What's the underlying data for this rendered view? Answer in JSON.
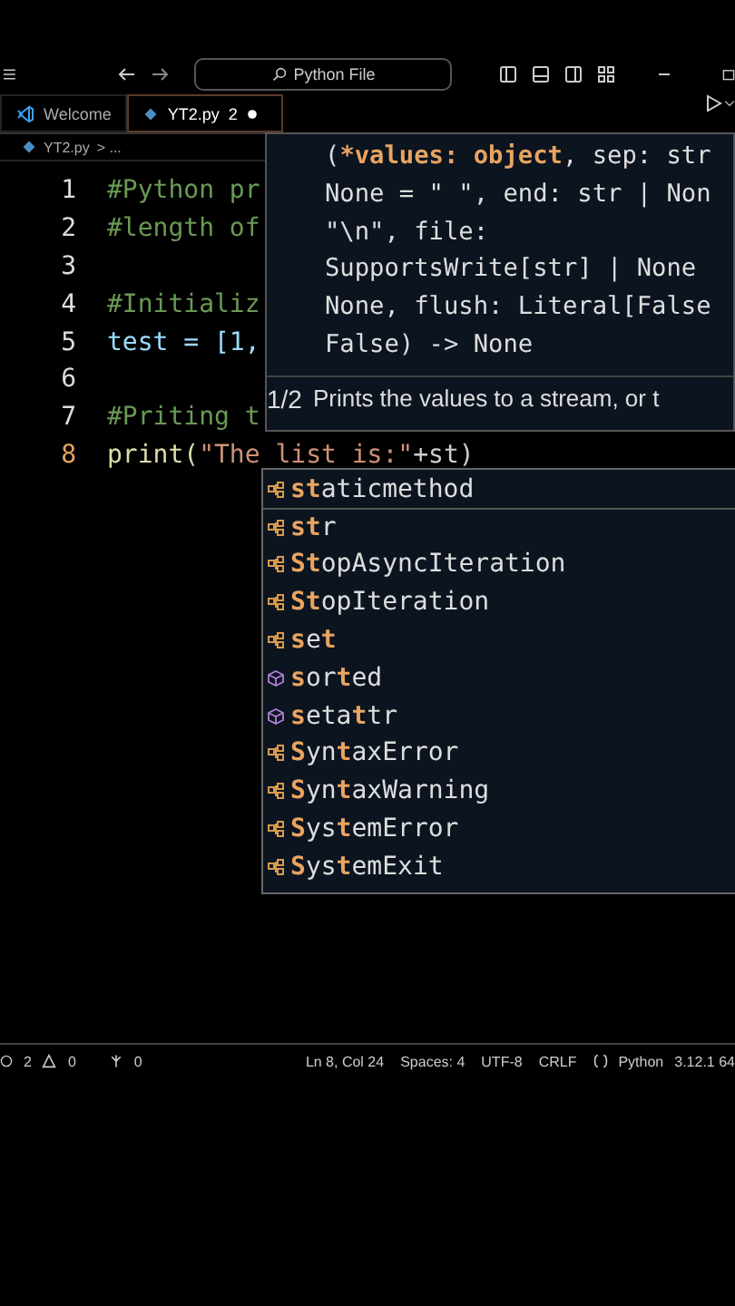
{
  "title_bar": {
    "search": "Python File"
  },
  "tabs": [
    {
      "label": "Welcome",
      "kind": "welcome",
      "selected": false,
      "modified": false
    },
    {
      "label": "YT2.py",
      "kind": "python",
      "selected": true,
      "problems": "2",
      "modified": true
    }
  ],
  "breadcrumb": {
    "file": "YT2.py",
    "rest": "> ..."
  },
  "code_lines": [
    {
      "number": "1",
      "text": "#Python pr",
      "kind": "comment",
      "current": false
    },
    {
      "number": "2",
      "text": "#length of",
      "kind": "comment",
      "current": false
    },
    {
      "number": "3",
      "kind": "blank",
      "current": false
    },
    {
      "number": "4",
      "text": "#Initializ",
      "kind": "comment",
      "current": false
    },
    {
      "number": "5",
      "text": "test = [1,",
      "kind": "assign",
      "current": false
    },
    {
      "number": "6",
      "kind": "blank",
      "current": false
    },
    {
      "number": "7",
      "text": "#Priting t",
      "kind": "comment",
      "current": false
    },
    {
      "number": "8",
      "text": "print(\"The list is:\"+st)",
      "kind": "call",
      "current": true
    }
  ],
  "hover": {
    "prefix": "(",
    "active_param": "*values: object",
    "lines": [
      ", sep: str",
      "None = \" \", end: str | Non",
      "\"\\n\", file:",
      "SupportsWrite[str] | None",
      "None, flush: Literal[False",
      "False) -> None"
    ],
    "counter": "1/2",
    "doc": "Prints the values to a stream, or t"
  },
  "suggestions": [
    {
      "label": "**st**aticmethod",
      "kind": "class",
      "selected": true
    },
    {
      "label": "**st**r",
      "kind": "class",
      "selected": false
    },
    {
      "label": "**St**opAsyncIteration",
      "kind": "class",
      "selected": false
    },
    {
      "label": "**St**opIteration",
      "kind": "class",
      "selected": false
    },
    {
      "label": "**s**e**t**",
      "kind": "class",
      "selected": false
    },
    {
      "label": "**s**or**t**ed",
      "kind": "function",
      "selected": false
    },
    {
      "label": "**s**eta**t**tr",
      "kind": "function",
      "selected": false
    },
    {
      "label": "**S**yn**t**axError",
      "kind": "class",
      "selected": false
    },
    {
      "label": "**S**yn**t**axWarning",
      "kind": "class",
      "selected": false
    },
    {
      "label": "**S**ys**t**emError",
      "kind": "class",
      "selected": false
    },
    {
      "label": "**S**ys**t**emExit",
      "kind": "class",
      "selected": false
    }
  ],
  "status_bar": {
    "errors": "2",
    "warnings": "0",
    "ports": "0",
    "right": [
      "Ln 8, Col 24",
      "Spaces: 4",
      "UTF-8",
      "CRLF"
    ],
    "language": "Python",
    "version": "3.12.1 64"
  }
}
